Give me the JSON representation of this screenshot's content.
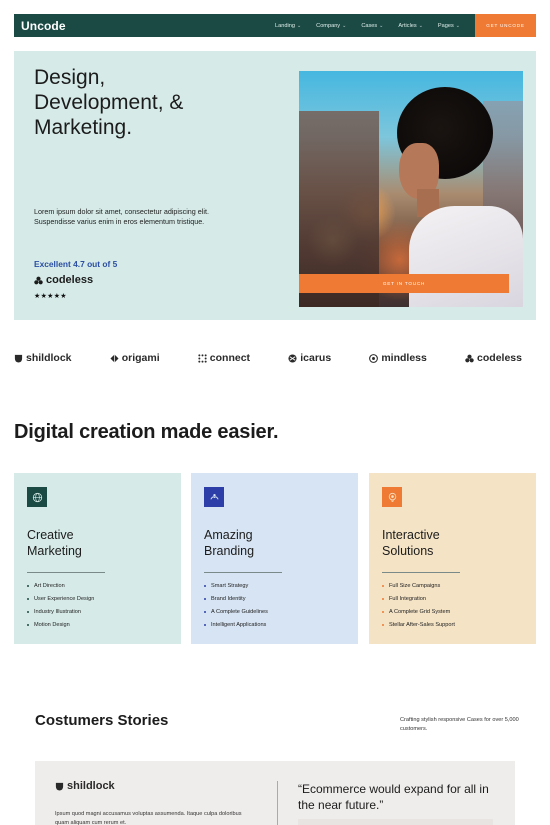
{
  "nav": {
    "logo": "Uncode",
    "items": [
      {
        "label": "Landing"
      },
      {
        "label": "Company"
      },
      {
        "label": "Cases"
      },
      {
        "label": "Articles"
      },
      {
        "label": "Pages"
      }
    ],
    "cta": "GET UNCODE",
    "bg_color": "#1b4a45",
    "accent": "#ef7a34"
  },
  "hero": {
    "title_lines": [
      "Design,",
      "Development, &",
      "Marketing."
    ],
    "description": "Lorem ipsum dolor sit amet, consectetur adipiscing elit. Suspendisse varius enim in eros elementum tristique.",
    "rating": "Excellent 4.7 out of 5",
    "brand": "codeless",
    "stars": "★★★★★",
    "cta": "GET IN TOUCH",
    "image_icon": "portrait-photo"
  },
  "logos": [
    {
      "name": "shildlock",
      "icon": "shield-icon"
    },
    {
      "name": "origami",
      "icon": "origami-icon"
    },
    {
      "name": "connect",
      "icon": "dots-grid-icon"
    },
    {
      "name": "icarus",
      "icon": "icarus-icon"
    },
    {
      "name": "mindless",
      "icon": "brain-icon"
    },
    {
      "name": "codeless",
      "icon": "triple-circle-icon"
    }
  ],
  "section": {
    "title": "Digital creation made easier."
  },
  "cards": [
    {
      "title_lines": [
        "Creative",
        "Marketing"
      ],
      "icon": "globe-icon",
      "items": [
        "Art Direction",
        "User Experience Design",
        "Industry Illustration",
        "Motion Design"
      ]
    },
    {
      "title_lines": [
        "Amazing",
        "Branding"
      ],
      "icon": "hands-icon",
      "items": [
        "Smart Strategy",
        "Brand Identity",
        "A Complete Guidelines",
        "Intelligent Applications"
      ]
    },
    {
      "title_lines": [
        "Interactive",
        "Solutions"
      ],
      "icon": "target-icon",
      "items": [
        "Full Size Campaigns",
        "Full Integration",
        "A Complete Grid System",
        "Stellar After-Sales Support"
      ]
    }
  ],
  "stories": {
    "title": "Costumers Stories",
    "description": "Crafting stylish responsive Cases for over 5,000 customers.",
    "card": {
      "brand": "shildlock",
      "text": "Ipsum quod magni accusamus voluptas assumenda. Itaque culpa doloribus quam aliquam cum rerum et.",
      "quote": "“Ecommerce would expand for all in the near future.”"
    }
  }
}
